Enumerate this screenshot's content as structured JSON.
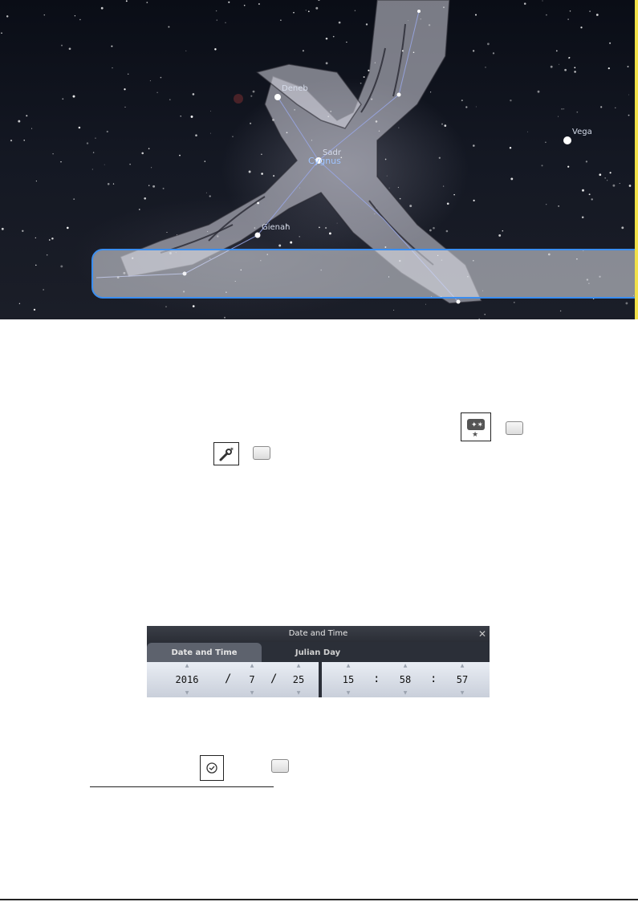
{
  "sky": {
    "stars": {
      "deneb": "Deneb",
      "sadr": "Sadr",
      "vega": "Vega",
      "gienah": "Gienah"
    },
    "constellation": "Cygnus"
  },
  "icons": {
    "sky_culture": "constellation-art-icon",
    "configuration": "wrench-icon",
    "date_time": "clock-icon"
  },
  "datetime_dialog": {
    "title": "Date and Time",
    "close_symbol": "✕",
    "tabs": {
      "date_and_time": "Date and Time",
      "julian_day": "Julian Day"
    },
    "year": "2016",
    "month": "7",
    "day": "25",
    "hour": "15",
    "minute": "58",
    "second": "57",
    "date_sep": "/",
    "time_sep": ":"
  },
  "colors": {
    "highlight_border": "#3b8ef0",
    "constellation_label": "#9ec3ff"
  }
}
